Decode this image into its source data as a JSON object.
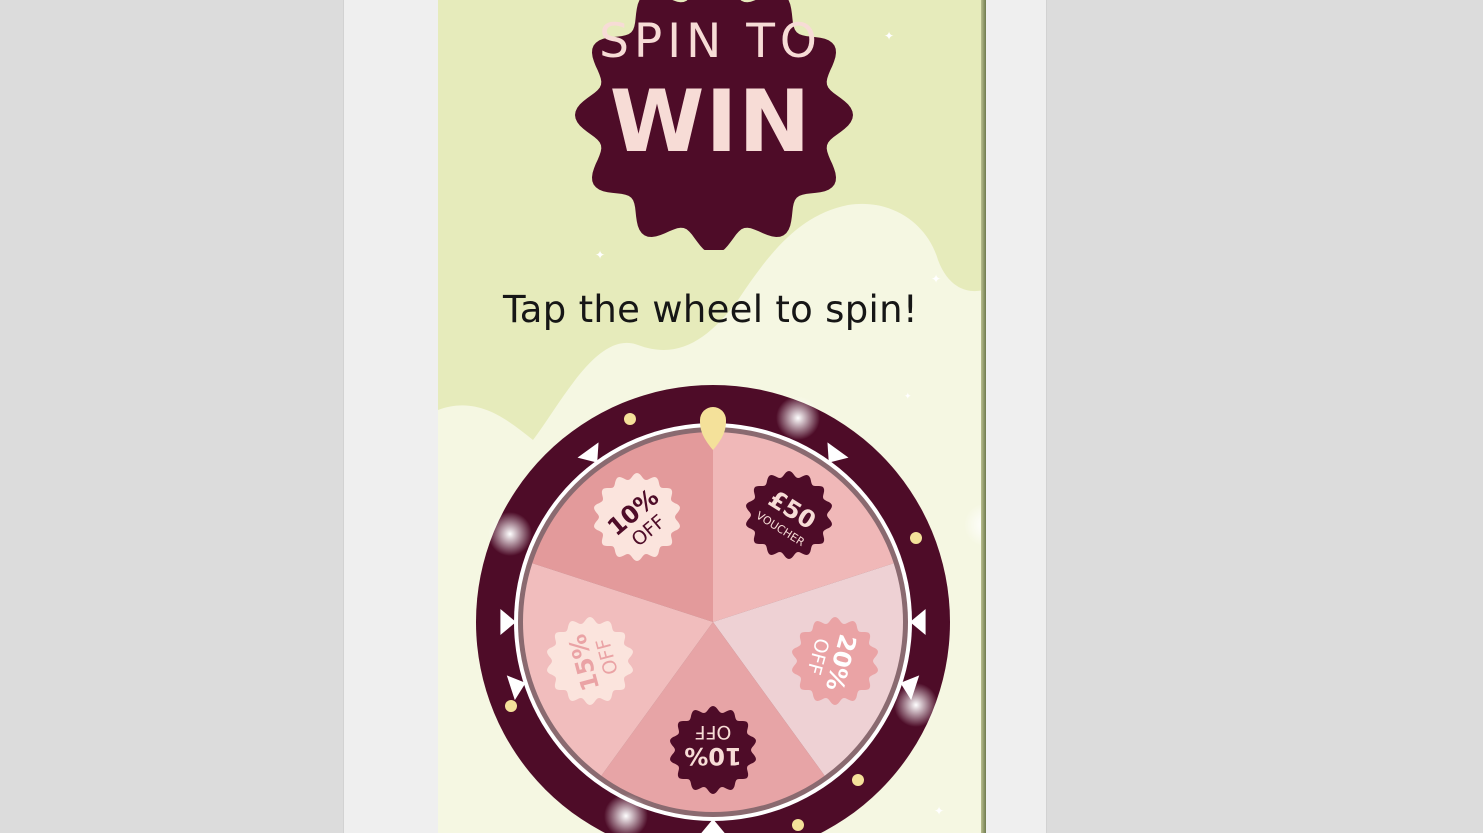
{
  "title": {
    "line1": "SPIN TO",
    "line2": "WIN"
  },
  "instruction": "Tap the wheel to spin!",
  "wheel": {
    "segments": [
      {
        "big": "10%",
        "small": "OFF"
      },
      {
        "big": "£50",
        "small": "VOUCHER"
      },
      {
        "big": "20%",
        "small": "OFF"
      },
      {
        "big": "10%",
        "small": "OFF"
      },
      {
        "big": "15%",
        "small": "OFF"
      }
    ]
  },
  "colors": {
    "background": "#e6ebbb",
    "blob": "#f5f7e2",
    "brand_dark": "#4e0c28",
    "badge_text": "#f7dcd6",
    "pointer": "#f4e19a"
  }
}
